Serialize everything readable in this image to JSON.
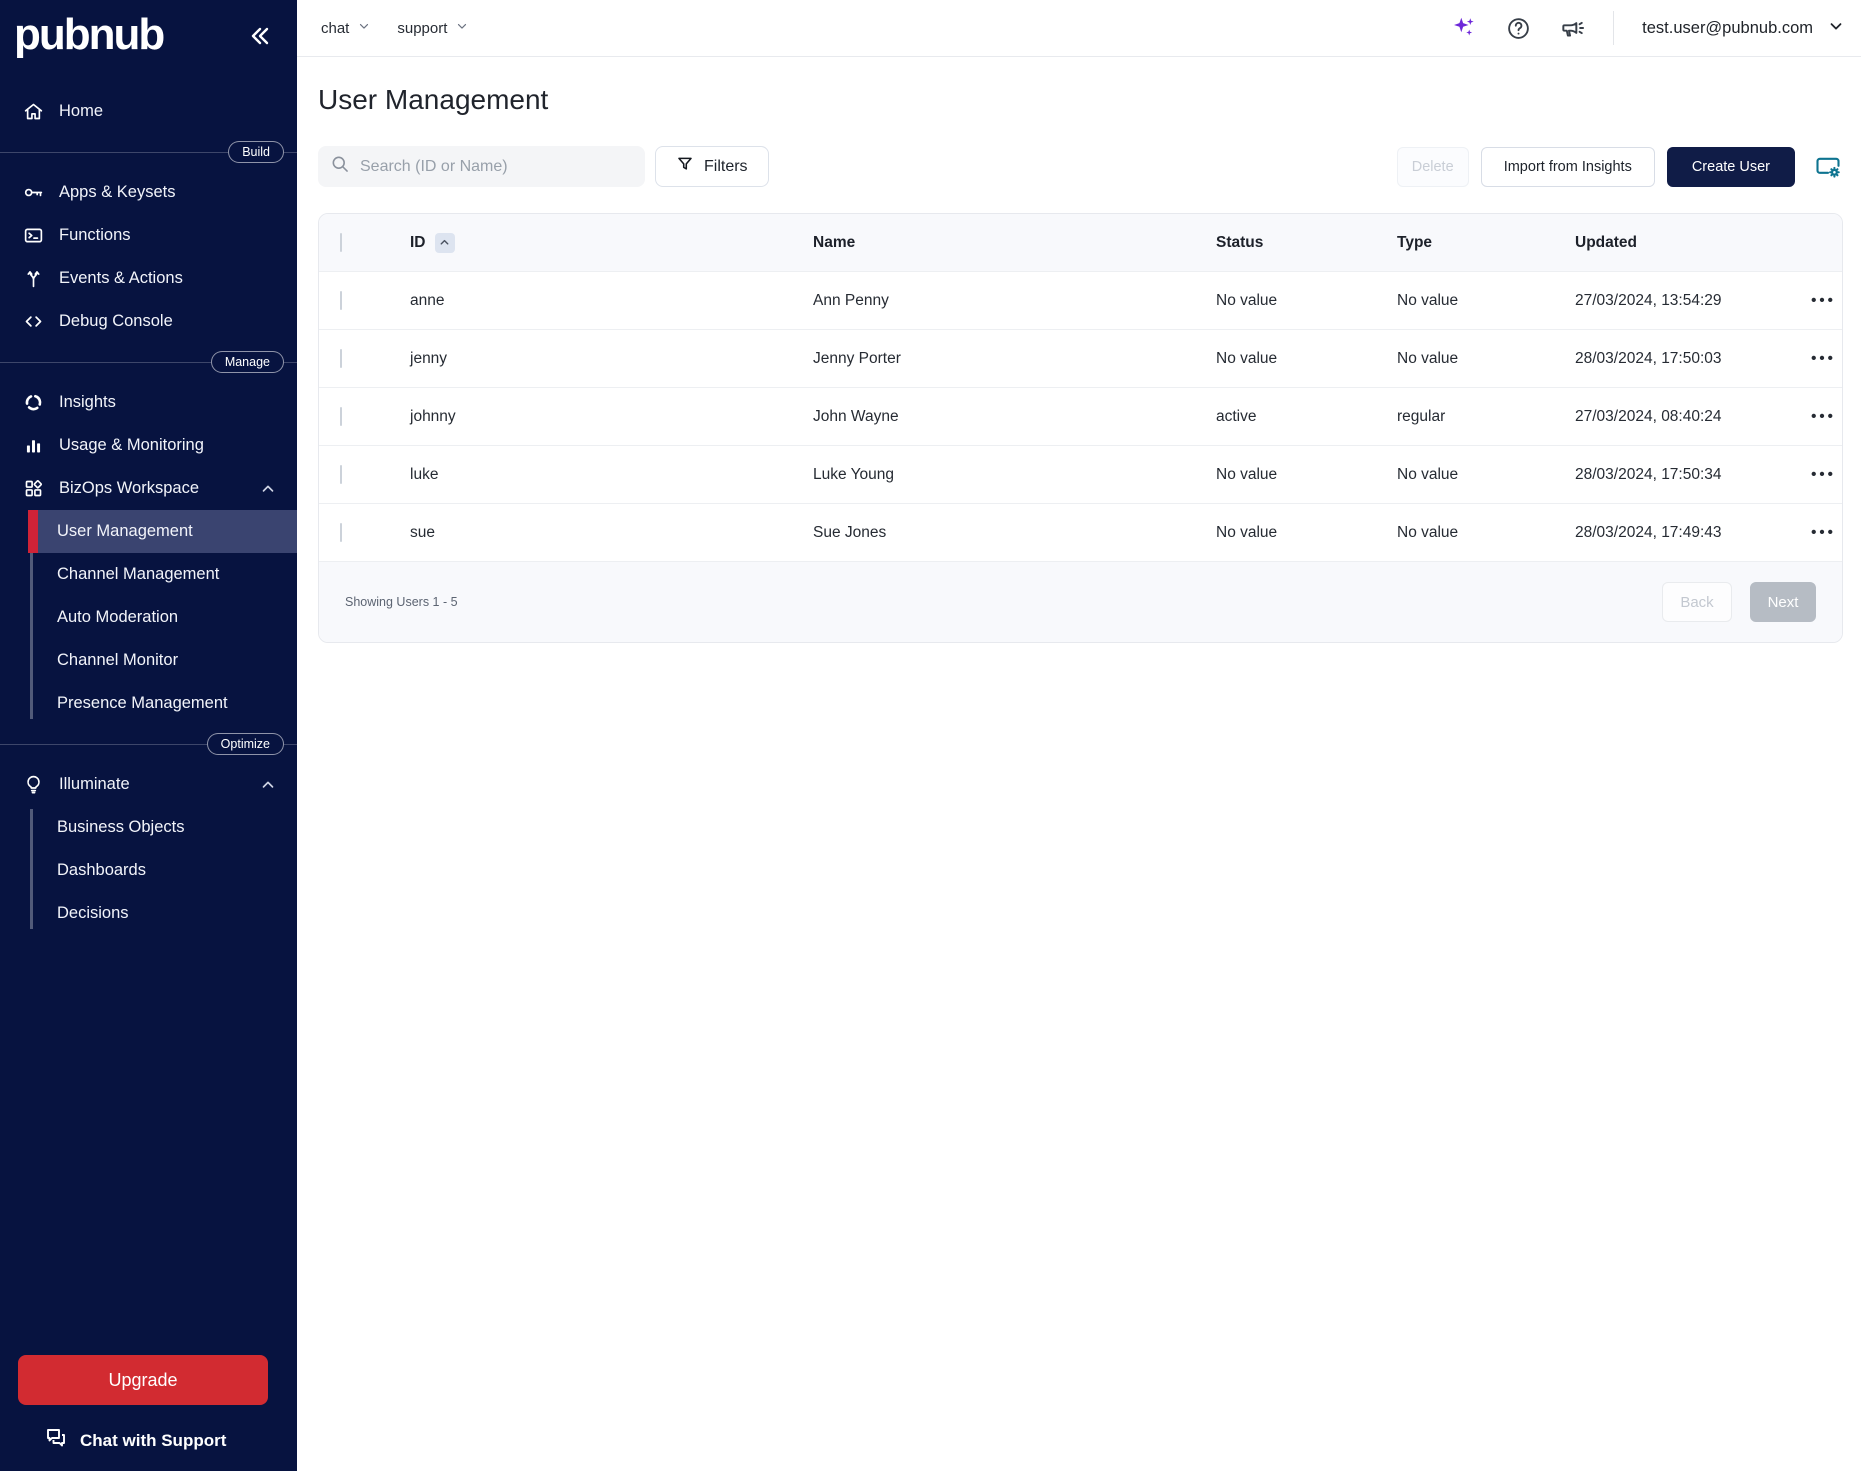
{
  "brand": {
    "logo": "pubnub"
  },
  "topbar": {
    "nav": [
      {
        "label": "chat"
      },
      {
        "label": "support"
      }
    ],
    "icons": [
      "sparkles-icon",
      "help-icon",
      "announcements-icon"
    ],
    "account": {
      "email": "test.user@pubnub.com"
    }
  },
  "sidebar": {
    "home": {
      "label": "Home"
    },
    "sections": [
      {
        "badge": "Build",
        "items": [
          {
            "label": "Apps & Keysets",
            "icon": "key-icon"
          },
          {
            "label": "Functions",
            "icon": "terminal-icon"
          },
          {
            "label": "Events & Actions",
            "icon": "split-arrows-icon"
          },
          {
            "label": "Debug Console",
            "icon": "code-icon"
          }
        ]
      },
      {
        "badge": "Manage",
        "items": [
          {
            "label": "Insights",
            "icon": "insights-ring-icon"
          },
          {
            "label": "Usage & Monitoring",
            "icon": "bar-chart-icon"
          },
          {
            "label": "BizOps Workspace",
            "icon": "grid-diamond-icon",
            "expanded": true,
            "children": [
              {
                "label": "User Management",
                "active": true
              },
              {
                "label": "Channel Management"
              },
              {
                "label": "Auto Moderation"
              },
              {
                "label": "Channel Monitor"
              },
              {
                "label": "Presence Management"
              }
            ]
          }
        ]
      },
      {
        "badge": "Optimize",
        "items": [
          {
            "label": "Illuminate",
            "icon": "lightbulb-icon",
            "expanded": true,
            "children": [
              {
                "label": "Business Objects"
              },
              {
                "label": "Dashboards"
              },
              {
                "label": "Decisions"
              }
            ]
          }
        ]
      }
    ],
    "upgrade_label": "Upgrade",
    "chat_support_label": "Chat with Support"
  },
  "main": {
    "title": "User Management",
    "search": {
      "placeholder": "Search (ID or Name)"
    },
    "filters_label": "Filters",
    "actions": {
      "delete": "Delete",
      "import": "Import from Insights",
      "create": "Create User"
    },
    "table": {
      "columns": {
        "id": "ID",
        "name": "Name",
        "status": "Status",
        "type": "Type",
        "updated": "Updated"
      },
      "rows": [
        {
          "id": "anne",
          "name": "Ann Penny",
          "status": "No value",
          "type": "No value",
          "updated": "27/03/2024, 13:54:29"
        },
        {
          "id": "jenny",
          "name": "Jenny Porter",
          "status": "No value",
          "type": "No value",
          "updated": "28/03/2024, 17:50:03"
        },
        {
          "id": "johnny",
          "name": "John Wayne",
          "status": "active",
          "type": "regular",
          "updated": "27/03/2024, 08:40:24"
        },
        {
          "id": "luke",
          "name": "Luke Young",
          "status": "No value",
          "type": "No value",
          "updated": "28/03/2024, 17:50:34"
        },
        {
          "id": "sue",
          "name": "Sue Jones",
          "status": "No value",
          "type": "No value",
          "updated": "28/03/2024, 17:49:43"
        }
      ],
      "footer": {
        "showing": "Showing Users 1 - 5",
        "back": "Back",
        "next": "Next"
      }
    }
  },
  "colors": {
    "sidebar_navy": "#071340",
    "active_item": "#3a4470",
    "accent_red": "#cf2337",
    "upgrade_red": "#d22b31",
    "create_button_navy": "#101c47",
    "sparkle_purple": "#6d28d9",
    "settings_teal": "#0e7490"
  }
}
